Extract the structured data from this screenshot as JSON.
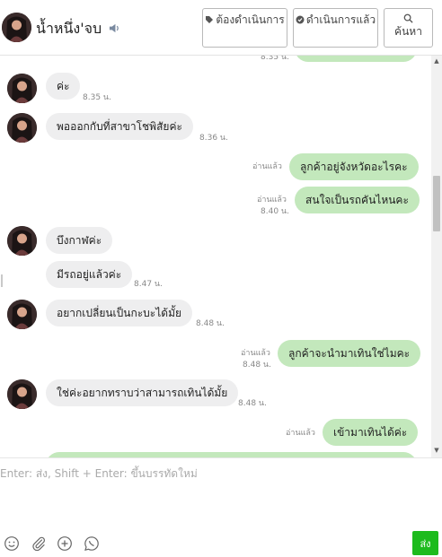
{
  "header": {
    "contact_name": "น้ำหนึ่ง'จบ",
    "todo_label": "ต้องดำเนินการ",
    "done_label": "ดำเนินการแล้ว",
    "search_label": "ค้นหา"
  },
  "messages": {
    "top_partial_time": "8.35 น.",
    "m1": {
      "text": "ค่ะ",
      "time": "8.35 น."
    },
    "m2": {
      "text": "พอออกกับที่สาขาโชพิสัยค่ะ",
      "time": "8.36 น."
    },
    "m3": {
      "text": "ลูกค้าอยู่จังหวัดอะไรคะ",
      "read": "อ่านแล้ว"
    },
    "m4": {
      "text": "สนใจเป็นรถคันไหนคะ",
      "read": "อ่านแล้ว",
      "time": "8.40 น."
    },
    "m5": {
      "text": "บึงกาฬค่ะ"
    },
    "m6": {
      "text": "มีรถอยู่แล้วค่ะ",
      "time": "8.47 น."
    },
    "m7": {
      "text": "อยากเปลี่ยนเป็นกะบะได้มั้ย",
      "time": "8.48 น."
    },
    "m8": {
      "text": "ลูกค้าจะนำมาเทินใช่ไมคะ",
      "read": "อ่านแล้ว",
      "time": "8.48 น."
    },
    "m9": {
      "text": "ใช่ค่ะอยากทราบว่าสามารถเทินได้มั้ย",
      "time": "8.48 น."
    },
    "m10": {
      "text": "เข้ามาเทินได้ค่ะ",
      "read": "อ่านแล้ว"
    }
  },
  "composer": {
    "placeholder": "Enter: ส่ง, Shift + Enter: ขึ้นบรรทัดใหม่",
    "send_label": "ส่ง"
  },
  "colors": {
    "outgoing_bubble": "#c3e8bc",
    "incoming_bubble": "#eeeeef",
    "send_button": "#1dbb1d"
  }
}
